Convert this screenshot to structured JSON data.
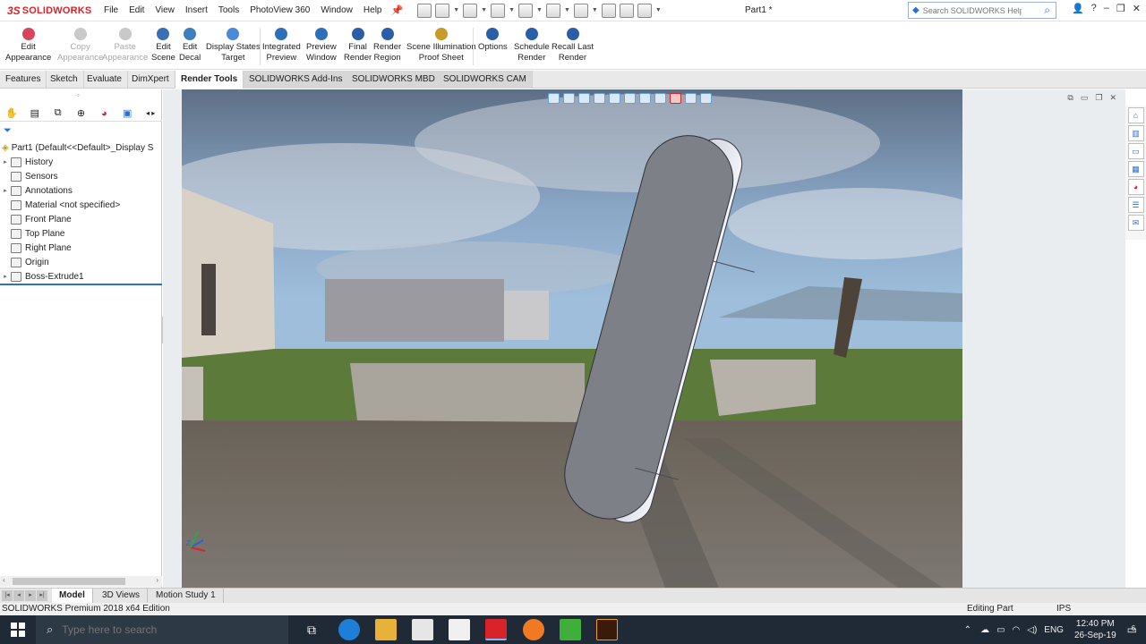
{
  "app": {
    "logo_ds": "3S",
    "logo_name": "SOLIDWORKS",
    "document_title": "Part1 *",
    "search_placeholder": "Search SOLIDWORKS Help"
  },
  "menu": [
    "File",
    "Edit",
    "View",
    "Insert",
    "Tools",
    "PhotoView 360",
    "Window",
    "Help"
  ],
  "toolbar": [
    {
      "line1": "Edit",
      "line2": "Appearance",
      "enabled": true,
      "color": "#d6455a"
    },
    {
      "line1": "Copy",
      "line2": "Appearance",
      "enabled": false,
      "color": "#c9c9c9"
    },
    {
      "line1": "Paste",
      "line2": "Appearance",
      "enabled": false,
      "color": "#c9c9c9"
    },
    {
      "line1": "Edit",
      "line2": "Scene",
      "enabled": true,
      "color": "#3b6fb5"
    },
    {
      "line1": "Edit",
      "line2": "Decal",
      "enabled": true,
      "color": "#3f7fbf"
    },
    {
      "line1": "Display States",
      "line2": "Target",
      "enabled": true,
      "color": "#4a8ad8"
    },
    {
      "line1": "Integrated",
      "line2": "Preview",
      "enabled": true,
      "color": "#2d6fb8"
    },
    {
      "line1": "Preview",
      "line2": "Window",
      "enabled": true,
      "color": "#2d6fb8"
    },
    {
      "line1": "Final",
      "line2": "Render",
      "enabled": true,
      "color": "#2a5fa8"
    },
    {
      "line1": "Render",
      "line2": "Region",
      "enabled": true,
      "color": "#2a5fa8"
    },
    {
      "line1": "Scene Illumination",
      "line2": "Proof Sheet",
      "enabled": true,
      "color": "#c89a2a"
    },
    {
      "line1": "Options",
      "line2": "",
      "enabled": true,
      "color": "#2a5fa8"
    },
    {
      "line1": "Schedule",
      "line2": "Render",
      "enabled": true,
      "color": "#2a5fa8"
    },
    {
      "line1": "Recall Last",
      "line2": "Render",
      "enabled": true,
      "color": "#2a5fa8"
    }
  ],
  "tabs": [
    "Features",
    "Sketch",
    "Evaluate",
    "DimXpert",
    "Render Tools",
    "SOLIDWORKS Add-Ins",
    "SOLIDWORKS MBD",
    "SOLIDWORKS CAM"
  ],
  "active_tab": "Render Tools",
  "feature_tree": {
    "root": "Part1  (Default<<Default>_Display S",
    "items": [
      {
        "label": "History",
        "expandable": true
      },
      {
        "label": "Sensors",
        "expandable": false
      },
      {
        "label": "Annotations",
        "expandable": true
      },
      {
        "label": "Material <not specified>",
        "expandable": false
      },
      {
        "label": "Front Plane",
        "expandable": false
      },
      {
        "label": "Top Plane",
        "expandable": false
      },
      {
        "label": "Right Plane",
        "expandable": false
      },
      {
        "label": "Origin",
        "expandable": false
      },
      {
        "label": "Boss-Extrude1",
        "expandable": true
      }
    ]
  },
  "bottom_tabs": [
    "Model",
    "3D Views",
    "Motion Study 1"
  ],
  "status": {
    "edition": "SOLIDWORKS Premium 2018 x64 Edition",
    "mode": "Editing Part",
    "units": "IPS"
  },
  "taskbar": {
    "search_placeholder": "Type here to search",
    "language": "ENG",
    "time": "12:40 PM",
    "date": "26-Sep-19",
    "notifications": "6"
  },
  "colors": {
    "brand": "#d8232a",
    "accent": "#2a6fd6",
    "sky": "#6f98bf",
    "body_face": "#7d8087",
    "body_side": "#eef0f6"
  }
}
